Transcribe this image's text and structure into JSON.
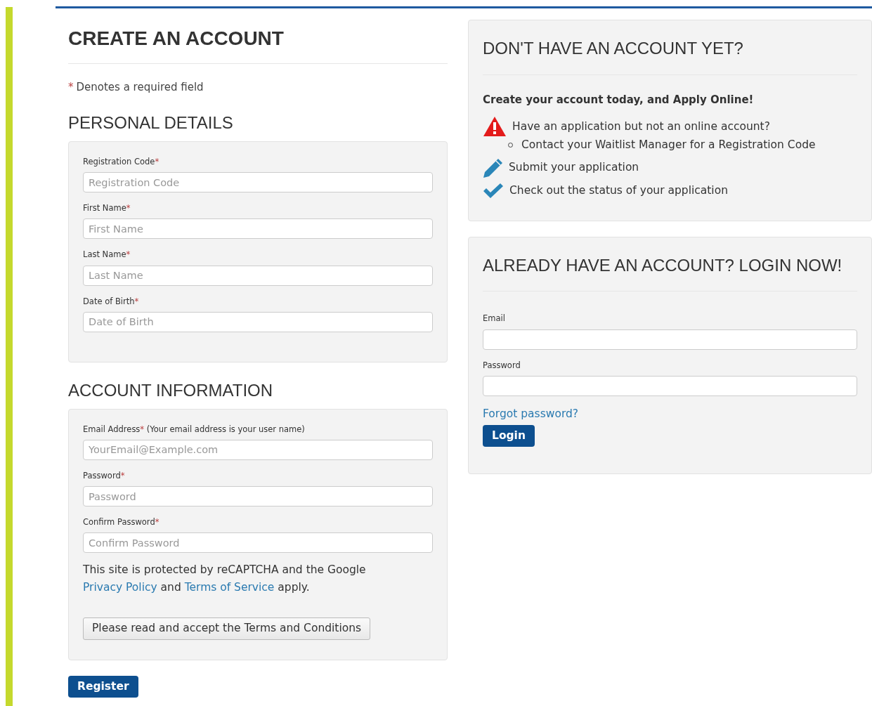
{
  "create": {
    "title": "CREATE AN ACCOUNT",
    "required_note": {
      "mark": "*",
      "text": "Denotes a required field"
    },
    "sections": [
      {
        "title": "PERSONAL DETAILS",
        "fields": [
          {
            "label": "Registration Code",
            "mark": "*",
            "placeholder": "Registration Code"
          },
          {
            "label": "First Name",
            "mark": "*",
            "placeholder": "First Name"
          },
          {
            "label": "Last Name",
            "mark": "*",
            "placeholder": "Last Name"
          },
          {
            "label": "Date of Birth",
            "mark": "*",
            "placeholder": "Date of Birth"
          }
        ]
      },
      {
        "title": "ACCOUNT INFORMATION",
        "fields": [
          {
            "label": "Email Address",
            "mark": "*",
            "note": "(Your email address is your user name)",
            "placeholder": "YourEmail@Example.com"
          },
          {
            "label": "Password",
            "mark": "*",
            "placeholder": "Password"
          },
          {
            "label": "Confirm Password",
            "mark": "*",
            "placeholder": "Confirm Password"
          }
        ],
        "notice": [
          {
            "kind": "text",
            "text": "This site is protected by reCAPTCHA and the Google "
          },
          {
            "kind": "link",
            "text": "Privacy Policy"
          },
          {
            "kind": "text",
            "text": " and "
          },
          {
            "kind": "link",
            "text": "Terms of Service"
          },
          {
            "kind": "text",
            "text": " apply."
          }
        ],
        "terms_button": "Please read and accept the Terms and Conditions"
      }
    ],
    "register_button": "Register"
  },
  "signup": {
    "title": "DON'T HAVE AN ACCOUNT YET?",
    "lead": "Create your account today, and Apply Online!",
    "items": [
      {
        "kind": "warning",
        "text": "Have an application but not an online account?",
        "children": [
          {
            "text": "Contact your Waitlist Manager for a Registration Code"
          }
        ]
      },
      {
        "kind": "pencil",
        "text": "Submit your application"
      },
      {
        "kind": "check",
        "text": "Check out the status of your application"
      }
    ]
  },
  "login": {
    "title": "ALREADY HAVE AN ACCOUNT? LOGIN NOW!",
    "fields": [
      {
        "label": "Email"
      },
      {
        "label": "Password"
      }
    ],
    "forgot_link": "Forgot password?",
    "login_button": "Login"
  }
}
